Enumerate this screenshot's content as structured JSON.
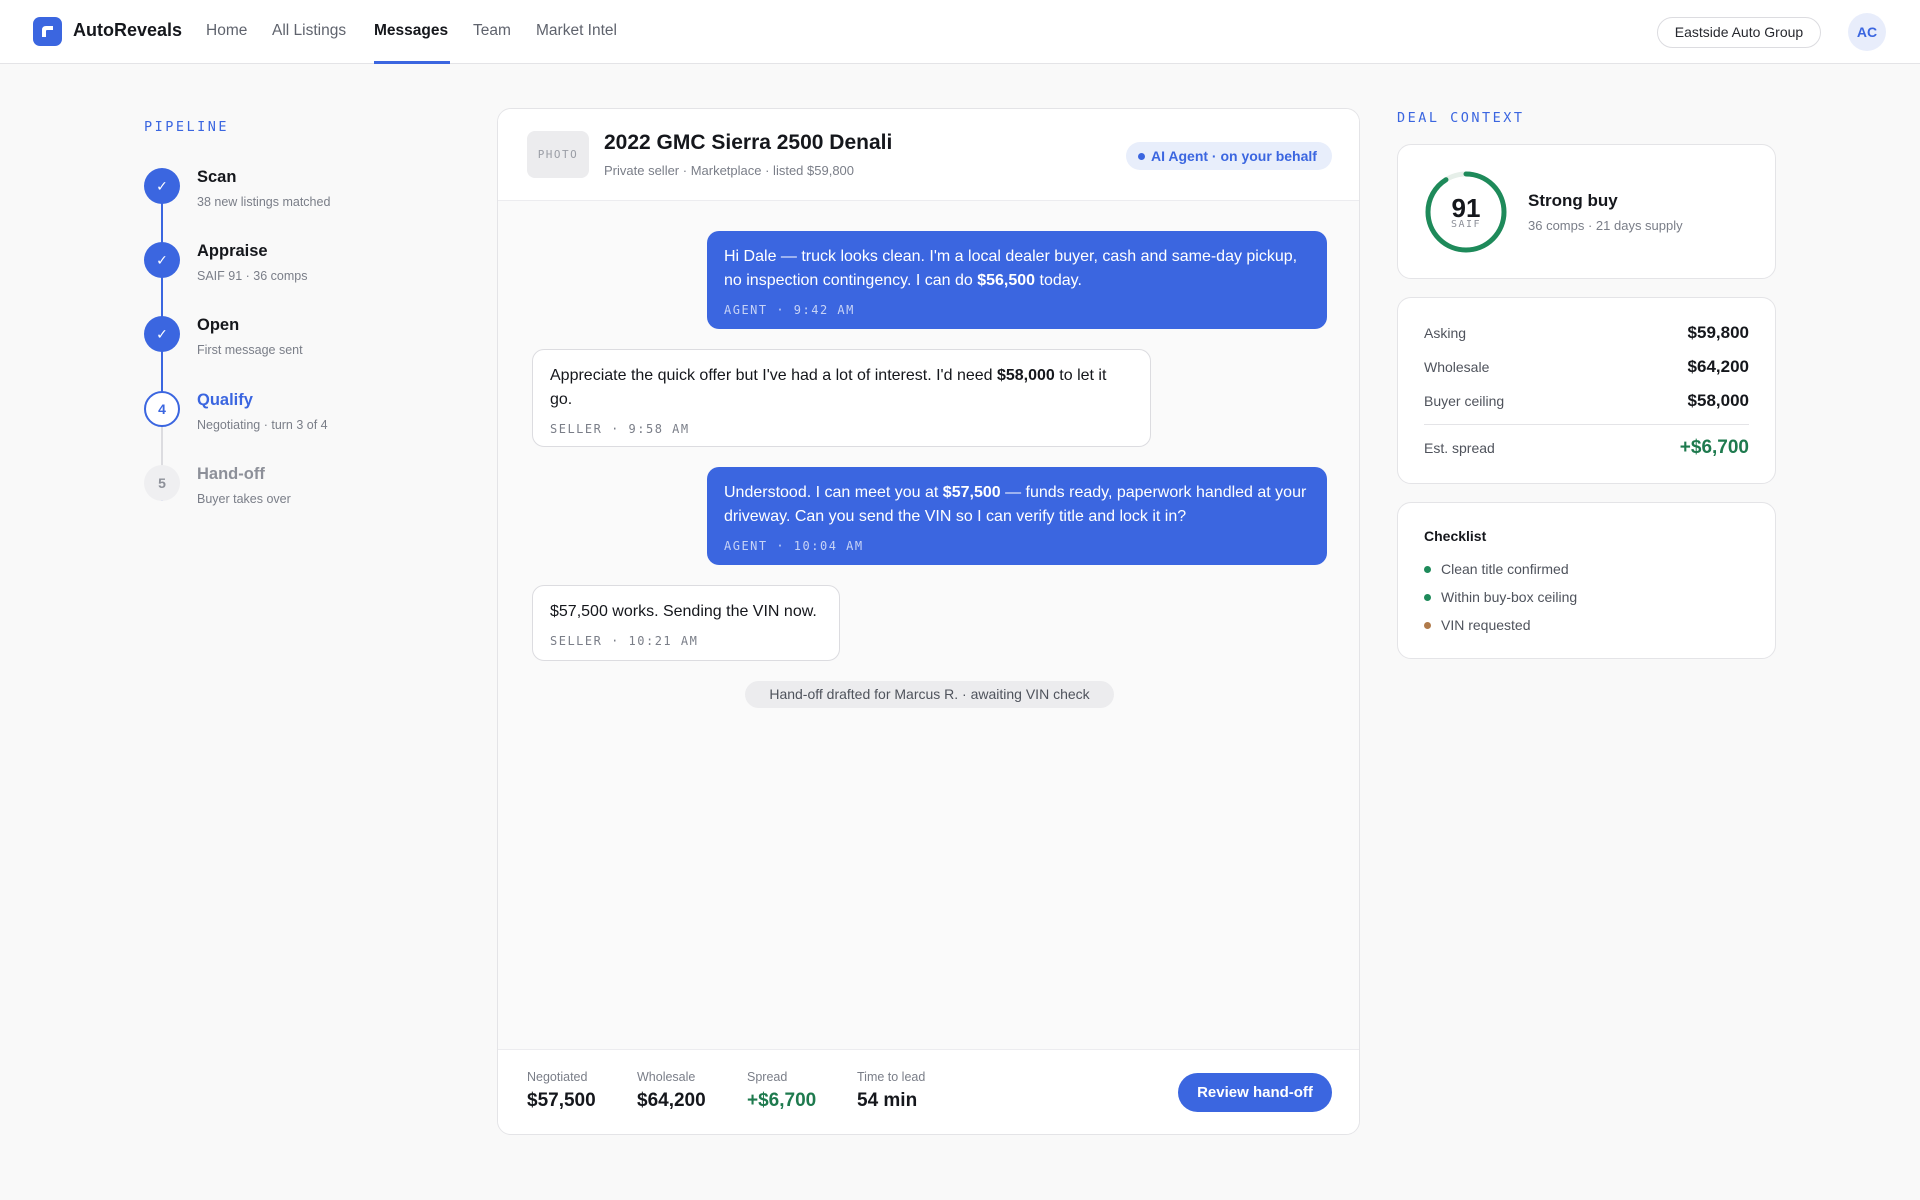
{
  "app": {
    "name": "AutoReveals"
  },
  "nav": {
    "items": [
      "Home",
      "All Listings",
      "Messages",
      "Team",
      "Market Intel"
    ],
    "active": "Messages"
  },
  "org": {
    "name": "Eastside Auto Group"
  },
  "user": {
    "initials": "AC"
  },
  "pipeline": {
    "title": "PIPELINE",
    "steps": [
      {
        "marker": "✓",
        "title": "Scan",
        "sub": "38 new listings matched",
        "state": "done"
      },
      {
        "marker": "✓",
        "title": "Appraise",
        "sub": "SAIF 91 · 36 comps",
        "state": "done"
      },
      {
        "marker": "✓",
        "title": "Open",
        "sub": "First message sent",
        "state": "done"
      },
      {
        "marker": "4",
        "title": "Qualify",
        "sub": "Negotiating · turn 3 of 4",
        "state": "current"
      },
      {
        "marker": "5",
        "title": "Hand-off",
        "sub": "Buyer takes over",
        "state": "future"
      }
    ]
  },
  "listing": {
    "photo_label": "PHOTO",
    "title": "2022 GMC Sierra 2500 Denali",
    "subtitle": "Private seller · Marketplace · listed $59,800",
    "agent_badge": "AI Agent · on your behalf"
  },
  "messages": [
    {
      "from": "agent",
      "pre": "Hi Dale — truck looks clean. I'm a local dealer buyer, cash and same-day pickup, no inspection contingency. I can do ",
      "bold": "$56,500",
      "post": " today.",
      "meta": "AGENT · 9:42 AM"
    },
    {
      "from": "seller",
      "pre": "Appreciate the quick offer but I've had a lot of interest. I'd need ",
      "bold": "$58,000",
      "post": " to let it go.",
      "meta": "SELLER · 9:58 AM"
    },
    {
      "from": "agent",
      "pre": "Understood. I can meet you at ",
      "bold": "$57,500",
      "post": " — funds ready, paperwork handled at your driveway. Can you send the VIN so I can verify title and lock it in?",
      "meta": "AGENT · 10:04 AM"
    },
    {
      "from": "seller",
      "pre": "$57,500 works. Sending the VIN now.",
      "bold": "",
      "post": "",
      "meta": "SELLER · 10:21 AM"
    }
  ],
  "system_note": "Hand-off drafted for Marcus R. · awaiting VIN check",
  "footer_stats": [
    {
      "label": "Negotiated",
      "value": "$57,500"
    },
    {
      "label": "Wholesale",
      "value": "$64,200"
    },
    {
      "label": "Spread",
      "value": "+$6,700"
    },
    {
      "label": "Time to lead",
      "value": "54 min"
    }
  ],
  "review_button": "Review hand-off",
  "deal_context": {
    "title": "DEAL CONTEXT",
    "score": {
      "value": "91",
      "fraction": 0.91,
      "label": "SAIF",
      "verdict": "Strong buy",
      "detail": "36 comps · 21 days supply"
    },
    "prices": [
      {
        "label": "Asking",
        "value": "$59,800"
      },
      {
        "label": "Wholesale",
        "value": "$64,200"
      },
      {
        "label": "Buyer ceiling",
        "value": "$58,000"
      }
    ],
    "spread": {
      "label": "Est. spread",
      "value": "+$6,700"
    },
    "checklist": {
      "title": "Checklist",
      "items": [
        {
          "label": "Clean title confirmed",
          "status": "done",
          "color": "#1e8a5a"
        },
        {
          "label": "Within buy-box ceiling",
          "status": "done",
          "color": "#1e8a5a"
        },
        {
          "label": "VIN requested",
          "status": "pending",
          "color": "#b07a4a"
        }
      ]
    }
  },
  "colors": {
    "accent": "#3b66e0",
    "positive": "#1e7a4e",
    "pending": "#b07a4a"
  },
  "icons": {
    "logo": "autoreveals-logo-icon",
    "check": "check-icon",
    "dot": "status-dot-icon"
  }
}
